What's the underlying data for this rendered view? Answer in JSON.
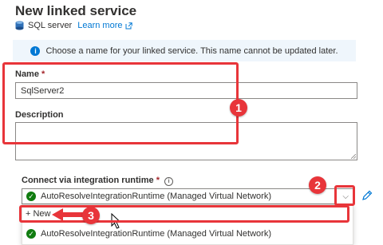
{
  "header": {
    "title": "New linked service",
    "service_type": "SQL server",
    "learn_more": "Learn more"
  },
  "info_banner": {
    "text": "Choose a name for your linked service. This name cannot be updated later."
  },
  "form": {
    "name_label": "Name",
    "name_required": "*",
    "name_value": "SqlServer2",
    "description_label": "Description",
    "description_value": "",
    "runtime_label": "Connect via integration runtime",
    "runtime_required": "*",
    "runtime_value": "AutoResolveIntegrationRuntime (Managed Virtual Network)"
  },
  "dropdown": {
    "new_label": "+ New",
    "options": [
      "AutoResolveIntegrationRuntime (Managed Virtual Network)"
    ]
  },
  "annotations": {
    "step1": "1",
    "step2": "2",
    "step3": "3",
    "color": "#e8353a"
  },
  "icons": {
    "service": "database-icon",
    "external": "external-link-icon",
    "info": "info-icon",
    "check": "check-circle-icon",
    "edit": "pencil-icon"
  },
  "colors": {
    "accent": "#0078d4",
    "info_bg": "#eff6fc",
    "success": "#107c10",
    "required": "#a4262c"
  }
}
